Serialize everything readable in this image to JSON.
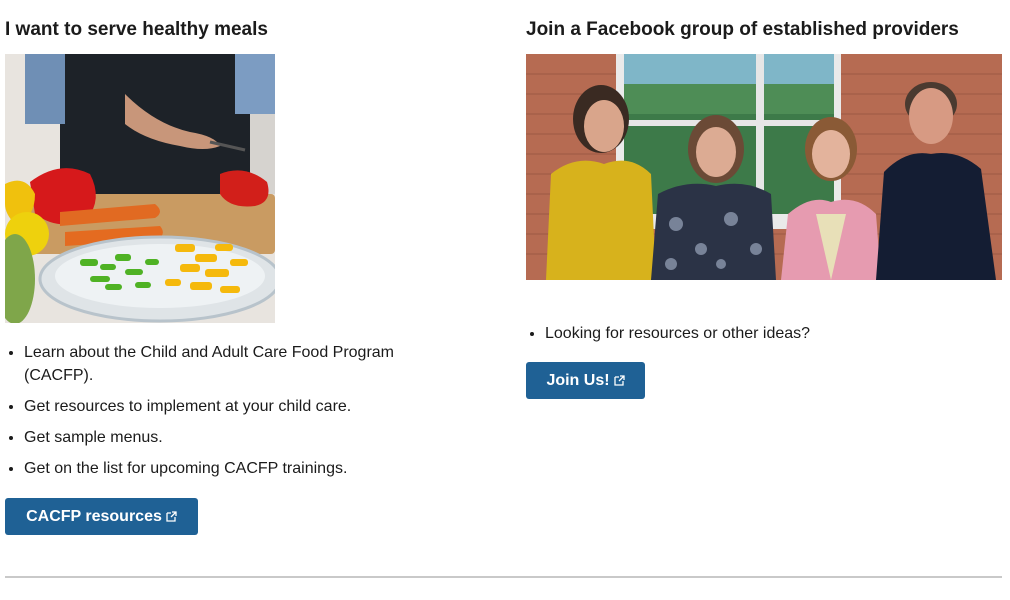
{
  "left_card": {
    "heading": "I want to serve healthy meals",
    "image_label": "Person chopping colorful bell peppers and carrots on a cutting board",
    "bullets": [
      "Learn about the Child and Adult Care Food Program (CACFP).",
      "Get resources to implement at your child care.",
      "Get sample menus.",
      "Get on the list for upcoming CACFP trainings."
    ],
    "button_label": "CACFP resources"
  },
  "right_card": {
    "heading": "Join a Facebook group of established providers",
    "image_label": "Four smiling people standing in front of a brick building",
    "bullets": [
      "Looking for resources or other ideas?"
    ],
    "button_label": "Join Us!"
  },
  "colors": {
    "button": "#1f6195",
    "divider": "#c9c9c9"
  },
  "icons": {
    "external_link": "external-link-icon"
  }
}
